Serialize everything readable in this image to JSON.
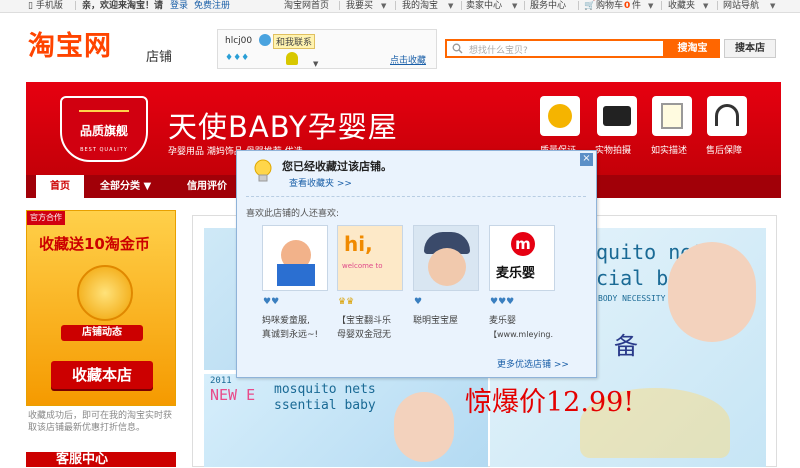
{
  "topbar": {
    "mobile": "手机版",
    "welcome": "亲，欢迎来淘宝！请",
    "login": "登录",
    "register": "免费注册",
    "links": [
      "淘宝网首页",
      "我要买",
      "我的淘宝",
      "卖家中心",
      "服务中心",
      "购物车",
      "0",
      "件",
      "收藏夹",
      "网站导航"
    ]
  },
  "header": {
    "logo": "淘宝网",
    "logo_sub": "店铺",
    "seller_name": "hlcj00",
    "contact": "和我联系",
    "favorite_link": "点击收藏",
    "search_placeholder": "想找什么宝贝?",
    "search_taobao": "搜淘宝",
    "search_store": "搜本店"
  },
  "banner": {
    "badge_title": "品质旗舰",
    "badge_sub": "BEST QUALITY",
    "store_title": "天使BABY孕婴屋",
    "store_sub": "孕婴用品 潮妈饰品 母婴推荐 优选",
    "features": [
      "质量保证",
      "实物拍摄",
      "如实描述",
      "售后保障"
    ]
  },
  "nav": {
    "items": [
      "首页",
      "全部分类 ▼",
      "信用评价"
    ]
  },
  "sidebar": {
    "corner": "官方合作",
    "ad_title": "收藏送10淘金币",
    "ad_tag": "店铺动态",
    "ad_button": "收藏本店",
    "note": "收藏成功后，即可在我的淘宝实时获取该店铺最新优惠打折信息。",
    "box2": "客服中心"
  },
  "main": {
    "mosquito1": "quito nets",
    "mosquito2": "cial baby",
    "mosquito3": "BODY NECESSITY",
    "year": "2011",
    "new_word": "NEW E",
    "mosquito4": "mosquito nets",
    "mosquito5": "ssential baby",
    "bei": "备",
    "price": "惊爆价12.99!"
  },
  "popup": {
    "message": "您已经收藏过该店铺。",
    "view_favorites": "查看收藏夹 >>",
    "like_label": "喜欢此店铺的人还喜欢:",
    "shops": [
      {
        "name1": "妈咪爱童服,",
        "name2": "真诚到永远~!"
      },
      {
        "name1": "【宝宝翻斗乐",
        "name2": "母婴双金冠无"
      },
      {
        "name1": "聪明宝宝屋",
        "name2": ""
      },
      {
        "name1": "麦乐婴",
        "name2": "【www.mleying."
      }
    ],
    "thumb3_text": "麦乐婴",
    "thumb2_text": "hi,",
    "thumb2_sub": "welcome to",
    "more": "更多优选店铺 >>",
    "close": "×"
  },
  "colors": {
    "taobao_orange": "#ff4400",
    "banner_red": "#e60010",
    "popup_bg": "#eaf3fd",
    "link_blue": "#1a5fa8"
  }
}
